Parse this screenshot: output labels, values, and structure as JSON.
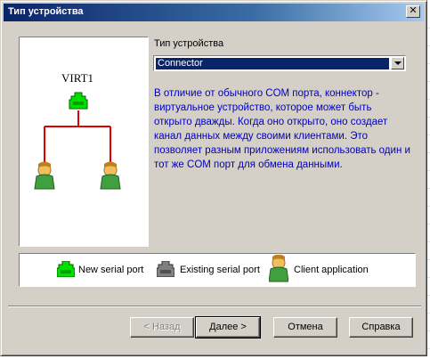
{
  "window": {
    "title": "Тип устройства",
    "close_symbol": "✕"
  },
  "diagram": {
    "port_name": "VIRT1"
  },
  "device_type": {
    "label": "Тип устройства",
    "selected": "Connector"
  },
  "description": "В отличие от обычного COM порта, коннектор - виртуальное устройство, которое может быть открыто дважды. Когда оно открыто, оно создает канал данных между своими клиентами. Это позволяет разным приложениям использовать один и тот же COM порт для обмена данными.",
  "legend": {
    "new_port": "New serial port",
    "existing_port": "Existing serial port",
    "client_app": "Client application"
  },
  "buttons": {
    "back": "< Назад",
    "next": "Далее >",
    "cancel": "Отмена",
    "help": "Справка"
  },
  "colors": {
    "new_port": "#00e000",
    "existing_port": "#808080",
    "connector_line": "#e00000",
    "description_text": "#0000c0"
  }
}
